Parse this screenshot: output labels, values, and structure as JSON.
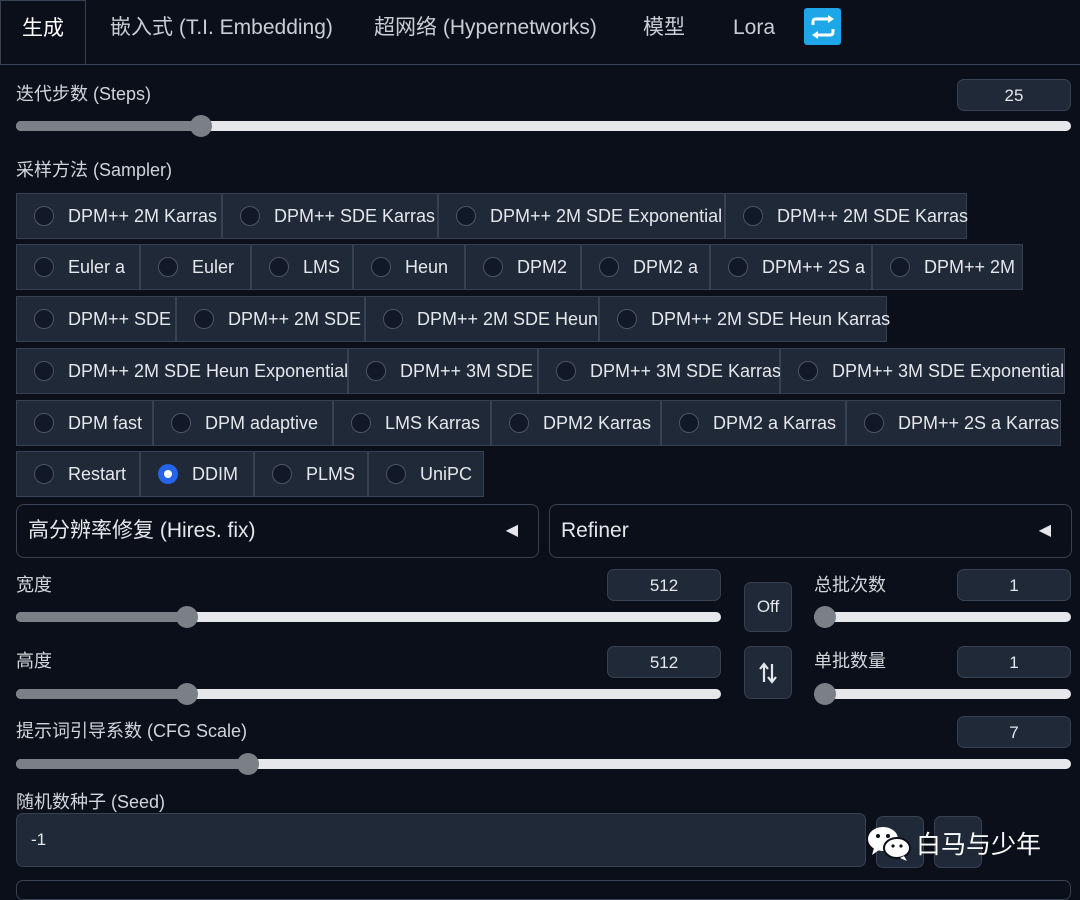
{
  "tabs": [
    {
      "label": "生成",
      "active": true
    },
    {
      "label": "嵌入式 (T.I. Embedding)"
    },
    {
      "label": "超网络 (Hypernetworks)"
    },
    {
      "label": "模型"
    },
    {
      "label": "Lora"
    }
  ],
  "refresh_icon": "refresh-icon",
  "steps": {
    "label": "迭代步数 (Steps)",
    "value": "25",
    "fraction": 0.168
  },
  "sampler": {
    "label": "采样方法 (Sampler)",
    "selected": "DDIM",
    "options": [
      "DPM++ 2M Karras",
      "DPM++ SDE Karras",
      "DPM++ 2M SDE Exponential",
      "DPM++ 2M SDE Karras",
      "Euler a",
      "Euler",
      "LMS",
      "Heun",
      "DPM2",
      "DPM2 a",
      "DPM++ 2S a",
      "DPM++ 2M",
      "DPM++ SDE",
      "DPM++ 2M SDE",
      "DPM++ 2M SDE Heun",
      "DPM++ 2M SDE Heun Karras",
      "DPM++ 2M SDE Heun Exponential",
      "DPM++ 3M SDE",
      "DPM++ 3M SDE Karras",
      "DPM++ 3M SDE Exponential",
      "DPM fast",
      "DPM adaptive",
      "LMS Karras",
      "DPM2 Karras",
      "DPM2 a Karras",
      "DPM++ 2S a Karras",
      "Restart",
      "DDIM",
      "PLMS",
      "UniPC"
    ]
  },
  "hires": {
    "label": "高分辨率修复 (Hires. fix)",
    "arrow": "◀"
  },
  "refiner": {
    "label": "Refiner",
    "arrow": "◀"
  },
  "width": {
    "label": "宽度",
    "value": "512",
    "fraction": 0.234
  },
  "height": {
    "label": "高度",
    "value": "512",
    "fraction": 0.234
  },
  "off_button": "Off",
  "swap_icon": "swap-icon",
  "batch_count": {
    "label": "总批次数",
    "value": "1",
    "fraction": 0.0
  },
  "batch_size": {
    "label": "单批数量",
    "value": "1",
    "fraction": 0.0
  },
  "cfg": {
    "label": "提示词引导系数 (CFG Scale)",
    "value": "7",
    "fraction": 0.214
  },
  "seed": {
    "label": "随机数种子 (Seed)",
    "value": "-1"
  },
  "watermark": {
    "text": "白马与少年",
    "icon": "wechat-icon"
  }
}
